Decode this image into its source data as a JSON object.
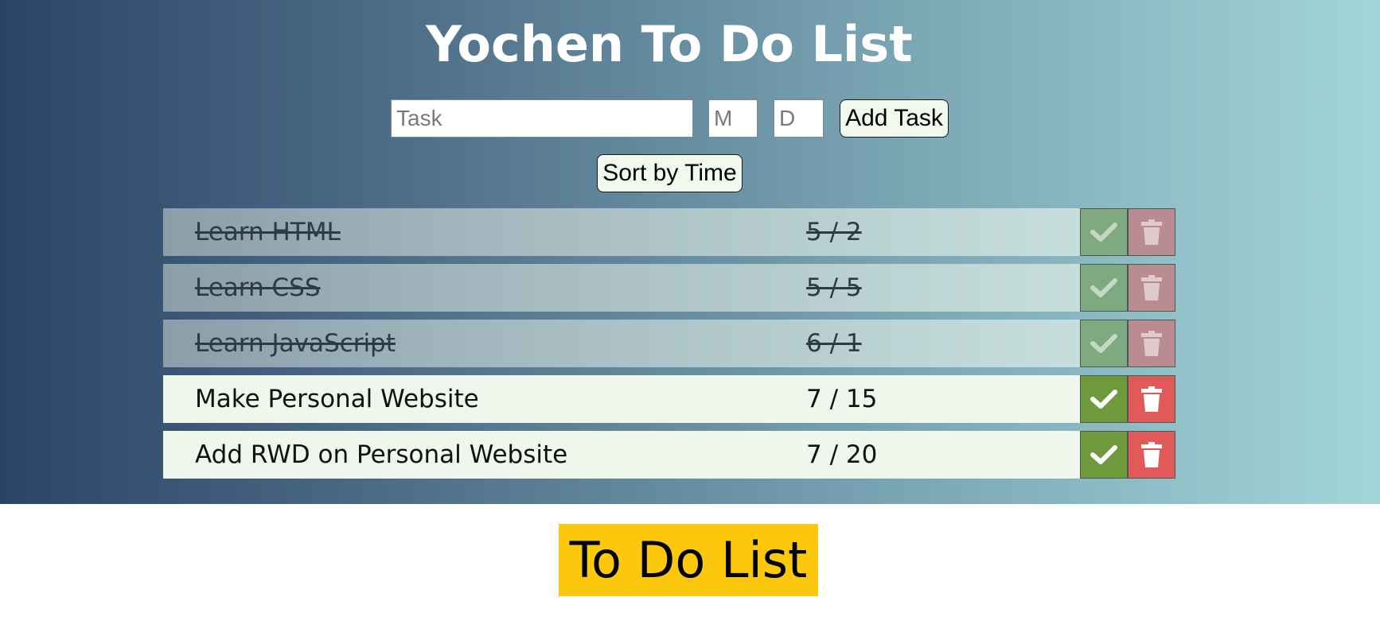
{
  "header": {
    "title": "Yochen To Do List"
  },
  "form": {
    "task_placeholder": "Task",
    "task_value": "",
    "month_placeholder": "M",
    "month_value": "",
    "day_placeholder": "D",
    "day_value": "",
    "add_label": "Add Task",
    "sort_label": "Sort by Time"
  },
  "todos": [
    {
      "name": "Learn HTML",
      "date": "5 / 2",
      "done": true
    },
    {
      "name": "Learn CSS",
      "date": "5 / 5",
      "done": true
    },
    {
      "name": "Learn JavaScript",
      "date": "6 / 1",
      "done": true
    },
    {
      "name": "Make Personal Website",
      "date": "7 / 15",
      "done": false
    },
    {
      "name": "Add RWD on Personal Website",
      "date": "7 / 20",
      "done": false
    }
  ],
  "icons": {
    "complete": "check-icon",
    "delete": "trash-icon"
  },
  "colors": {
    "complete_button": "#6e9a3c",
    "delete_button": "#e05a5a",
    "item_background": "#eff7ec",
    "banner": "#fcc80d"
  },
  "footer": {
    "banner_text": "To Do List"
  }
}
